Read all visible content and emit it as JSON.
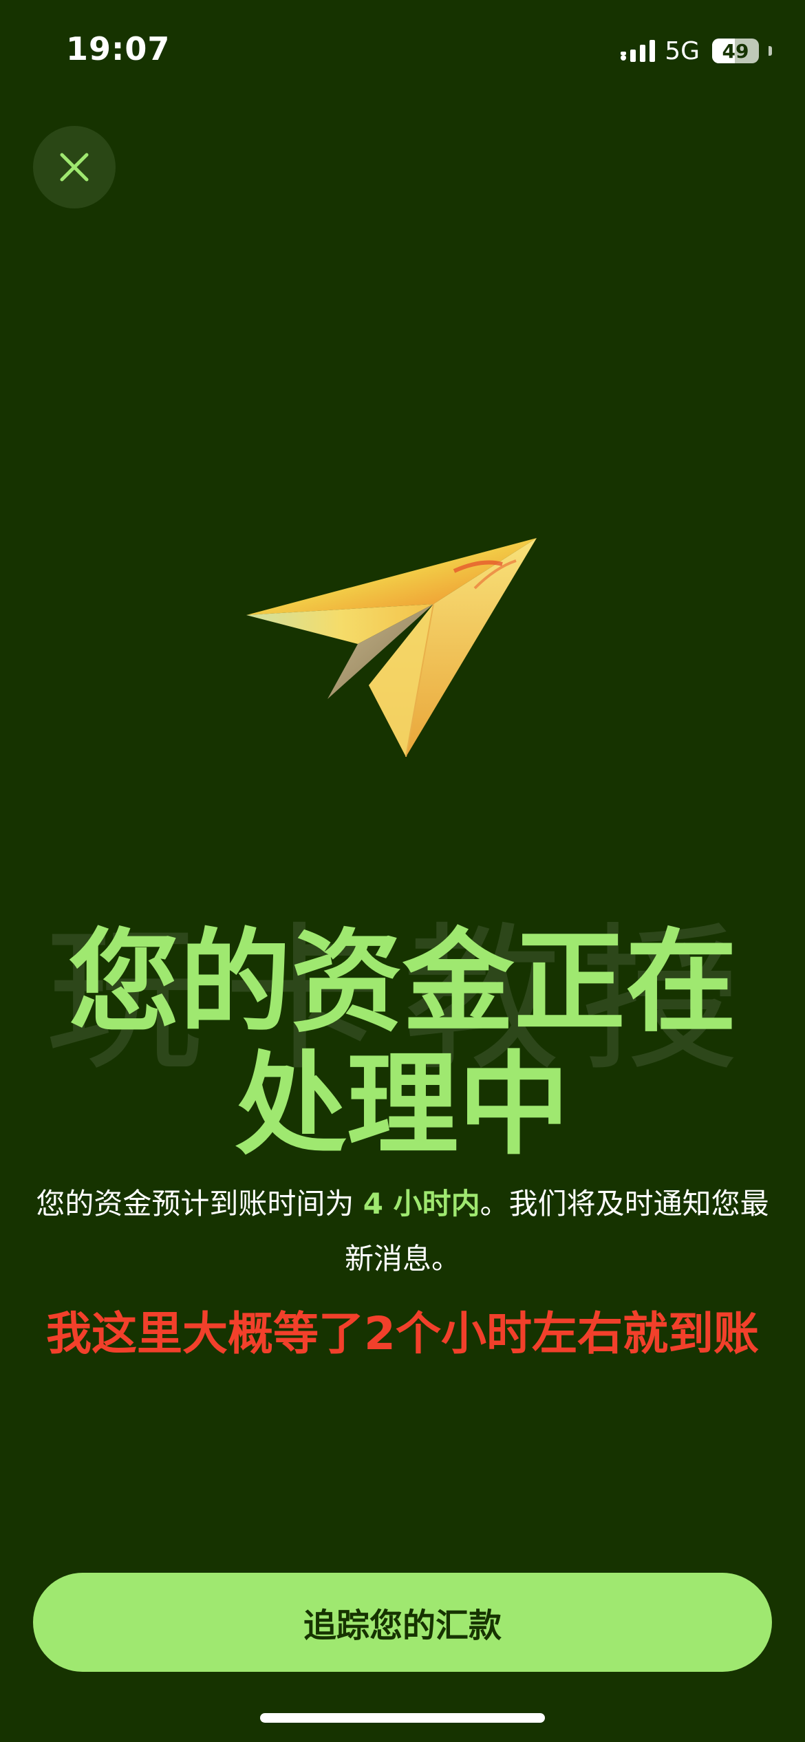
{
  "status_bar": {
    "time": "19:07",
    "network": "5G",
    "battery": "49",
    "battery_level": 0.49
  },
  "close_button": {
    "icon": "close-icon",
    "color": "#9fe870"
  },
  "hero": {
    "icon": "paper-plane-icon"
  },
  "watermark": {
    "text": "玩卡教授"
  },
  "title": {
    "line1": "您的资金正在",
    "line2": "处理中"
  },
  "description": {
    "prefix": "您的资金预计到账时间为 ",
    "highlight": "4 小时内",
    "suffix": "。我们将及时通知您最新消息。"
  },
  "annotation": {
    "text": "我这里大概等了2个小时左右就到账"
  },
  "primary_button": {
    "label": "追踪您的汇款"
  },
  "colors": {
    "background": "#163300",
    "accent": "#9fe870",
    "annotation": "#f2402b"
  }
}
